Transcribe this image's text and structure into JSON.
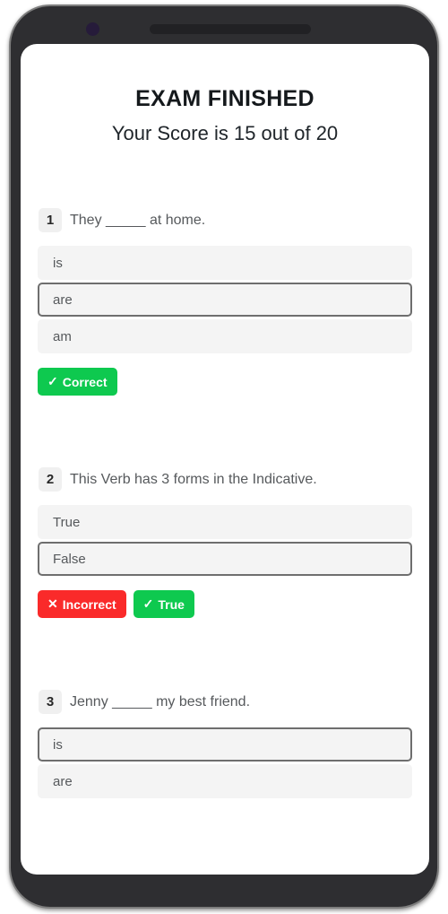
{
  "device": {
    "frame_color": "#2e2e31",
    "camera_icon": "camera-dot",
    "speaker_icon": "speaker-slot"
  },
  "header": {
    "title": "EXAM FINISHED",
    "score_text": "Your Score is 15 out of 20",
    "score_value": 15,
    "score_total": 20
  },
  "colors": {
    "correct_green": "#0ec94f",
    "incorrect_red": "#fa2a2a",
    "option_background": "#f4f4f4",
    "selected_border": "#6e6e6e",
    "number_badge_background": "#f0f0f0"
  },
  "questions": [
    {
      "number": "1",
      "text": "They _____ at home.",
      "options": [
        {
          "label": "is",
          "selected": false
        },
        {
          "label": "are",
          "selected": true
        },
        {
          "label": "am",
          "selected": false
        }
      ],
      "badges": [
        {
          "mark": "✓",
          "label": "Correct",
          "kind": "correct"
        }
      ]
    },
    {
      "number": "2",
      "text": "This Verb has 3 forms in the Indicative.",
      "options": [
        {
          "label": "True",
          "selected": false
        },
        {
          "label": "False",
          "selected": true
        }
      ],
      "badges": [
        {
          "mark": "✕",
          "label": "Incorrect",
          "kind": "incorrect"
        },
        {
          "mark": "✓",
          "label": "True",
          "kind": "correct"
        }
      ]
    },
    {
      "number": "3",
      "text": "Jenny _____ my best friend.",
      "options": [
        {
          "label": "is",
          "selected": true
        },
        {
          "label": "are",
          "selected": false
        }
      ],
      "badges": []
    }
  ]
}
